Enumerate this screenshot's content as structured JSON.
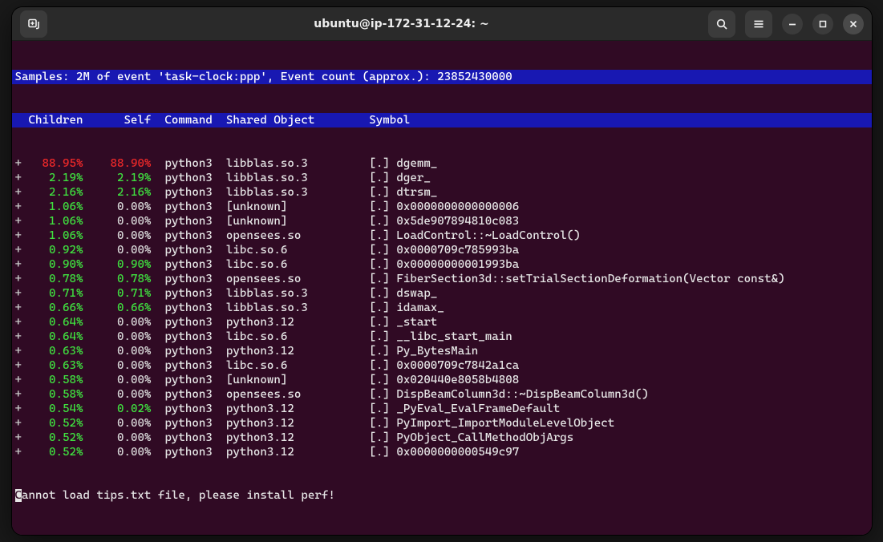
{
  "window": {
    "title": "ubuntu@ip-172-31-12-24: ~"
  },
  "header": {
    "samples": "Samples: 2M of event 'task-clock:ppp', Event count (approx.): 23852430000",
    "cols": "  Children      Self  Command  Shared Object        Symbol"
  },
  "footer": {
    "first": "C",
    "rest": "annot load tips.txt file, please install perf!"
  },
  "rows": [
    {
      "children": "88.95%",
      "childColor": "red",
      "self": "88.90%",
      "selfColor": "red",
      "command": "python3",
      "object": "libblas.so.3",
      "symbol": "[.] dgemm_"
    },
    {
      "children": "2.19%",
      "childColor": "green",
      "self": "2.19%",
      "selfColor": "green",
      "command": "python3",
      "object": "libblas.so.3",
      "symbol": "[.] dger_"
    },
    {
      "children": "2.16%",
      "childColor": "green",
      "self": "2.16%",
      "selfColor": "green",
      "command": "python3",
      "object": "libblas.so.3",
      "symbol": "[.] dtrsm_"
    },
    {
      "children": "1.06%",
      "childColor": "green",
      "self": "0.00%",
      "selfColor": "none",
      "command": "python3",
      "object": "[unknown]",
      "symbol": "[.] 0x0000000000000006"
    },
    {
      "children": "1.06%",
      "childColor": "green",
      "self": "0.00%",
      "selfColor": "none",
      "command": "python3",
      "object": "[unknown]",
      "symbol": "[.] 0x5de907894810c083"
    },
    {
      "children": "1.06%",
      "childColor": "green",
      "self": "0.00%",
      "selfColor": "none",
      "command": "python3",
      "object": "opensees.so",
      "symbol": "[.] LoadControl::~LoadControl()"
    },
    {
      "children": "0.92%",
      "childColor": "green",
      "self": "0.00%",
      "selfColor": "none",
      "command": "python3",
      "object": "libc.so.6",
      "symbol": "[.] 0x0000709c785993ba"
    },
    {
      "children": "0.90%",
      "childColor": "green",
      "self": "0.90%",
      "selfColor": "green",
      "command": "python3",
      "object": "libc.so.6",
      "symbol": "[.] 0x00000000001993ba"
    },
    {
      "children": "0.78%",
      "childColor": "green",
      "self": "0.78%",
      "selfColor": "green",
      "command": "python3",
      "object": "opensees.so",
      "symbol": "[.] FiberSection3d::setTrialSectionDeformation(Vector const&)"
    },
    {
      "children": "0.71%",
      "childColor": "green",
      "self": "0.71%",
      "selfColor": "green",
      "command": "python3",
      "object": "libblas.so.3",
      "symbol": "[.] dswap_"
    },
    {
      "children": "0.66%",
      "childColor": "green",
      "self": "0.66%",
      "selfColor": "green",
      "command": "python3",
      "object": "libblas.so.3",
      "symbol": "[.] idamax_"
    },
    {
      "children": "0.64%",
      "childColor": "green",
      "self": "0.00%",
      "selfColor": "none",
      "command": "python3",
      "object": "python3.12",
      "symbol": "[.] _start"
    },
    {
      "children": "0.64%",
      "childColor": "green",
      "self": "0.00%",
      "selfColor": "none",
      "command": "python3",
      "object": "libc.so.6",
      "symbol": "[.] __libc_start_main"
    },
    {
      "children": "0.63%",
      "childColor": "green",
      "self": "0.00%",
      "selfColor": "none",
      "command": "python3",
      "object": "python3.12",
      "symbol": "[.] Py_BytesMain"
    },
    {
      "children": "0.63%",
      "childColor": "green",
      "self": "0.00%",
      "selfColor": "none",
      "command": "python3",
      "object": "libc.so.6",
      "symbol": "[.] 0x0000709c7842a1ca"
    },
    {
      "children": "0.58%",
      "childColor": "green",
      "self": "0.00%",
      "selfColor": "none",
      "command": "python3",
      "object": "[unknown]",
      "symbol": "[.] 0x020440e8058b4808"
    },
    {
      "children": "0.58%",
      "childColor": "green",
      "self": "0.00%",
      "selfColor": "none",
      "command": "python3",
      "object": "opensees.so",
      "symbol": "[.] DispBeamColumn3d::~DispBeamColumn3d()"
    },
    {
      "children": "0.54%",
      "childColor": "green",
      "self": "0.02%",
      "selfColor": "green",
      "command": "python3",
      "object": "python3.12",
      "symbol": "[.] _PyEval_EvalFrameDefault"
    },
    {
      "children": "0.52%",
      "childColor": "green",
      "self": "0.00%",
      "selfColor": "none",
      "command": "python3",
      "object": "python3.12",
      "symbol": "[.] PyImport_ImportModuleLevelObject"
    },
    {
      "children": "0.52%",
      "childColor": "green",
      "self": "0.00%",
      "selfColor": "none",
      "command": "python3",
      "object": "python3.12",
      "symbol": "[.] PyObject_CallMethodObjArgs"
    },
    {
      "children": "0.52%",
      "childColor": "green",
      "self": "0.00%",
      "selfColor": "none",
      "command": "python3",
      "object": "python3.12",
      "symbol": "[.] 0x0000000000549c97"
    }
  ]
}
